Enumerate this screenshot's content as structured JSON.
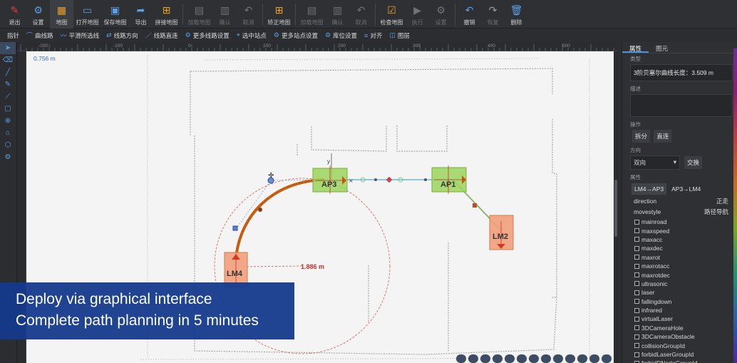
{
  "toolbar": [
    {
      "label": "退出",
      "icon": "exit-icon",
      "state": "normal"
    },
    {
      "label": "设置",
      "icon": "settings-icon",
      "state": "normal"
    },
    {
      "label": "地图",
      "icon": "map-grid-icon",
      "state": "active"
    },
    {
      "label": "打开地图",
      "icon": "folder-open-icon",
      "state": "normal"
    },
    {
      "label": "保存地图",
      "icon": "save-icon",
      "state": "normal"
    },
    {
      "label": "导出",
      "icon": "export-icon",
      "state": "normal"
    },
    {
      "label": "拼接地图",
      "icon": "merge-map-icon",
      "state": "normal"
    },
    {
      "label": "加载地图",
      "icon": "load-map-icon",
      "state": "disabled"
    },
    {
      "label": "确认",
      "icon": "confirm-icon",
      "state": "disabled"
    },
    {
      "label": "取消",
      "icon": "undo-cancel-icon",
      "state": "disabled"
    },
    {
      "label": "矫正地图",
      "icon": "correct-map-icon",
      "state": "normal"
    },
    {
      "label": "加载地图",
      "icon": "load-map-icon",
      "state": "disabled"
    },
    {
      "label": "确认",
      "icon": "confirm-icon",
      "state": "disabled"
    },
    {
      "label": "取消",
      "icon": "undo-cancel-icon",
      "state": "disabled"
    },
    {
      "label": "检查地图",
      "icon": "check-map-icon",
      "state": "normal"
    },
    {
      "label": "执行",
      "icon": "play-icon",
      "state": "disabled"
    },
    {
      "label": "设置",
      "icon": "gear-icon",
      "state": "disabled"
    },
    {
      "label": "撤销",
      "icon": "undo-icon",
      "state": "normal"
    },
    {
      "label": "恢复",
      "icon": "redo-icon",
      "state": "disabled"
    },
    {
      "label": "删除",
      "icon": "trash-icon",
      "state": "normal"
    }
  ],
  "toolbar2": [
    {
      "label": "指针",
      "icon": ""
    },
    {
      "label": "曲线路",
      "icon": "curve-path-icon"
    },
    {
      "label": "平滑所选线",
      "icon": "smooth-line-icon"
    },
    {
      "label": "线路方向",
      "icon": "line-direction-icon"
    },
    {
      "label": "线路直连",
      "icon": "line-straight-icon"
    },
    {
      "label": "更多线路设置",
      "icon": "more-line-settings-icon"
    },
    {
      "label": "选中站点",
      "icon": "select-station-icon"
    },
    {
      "label": "更多站点设置",
      "icon": "more-station-settings-icon"
    },
    {
      "label": "库位设置",
      "icon": "storage-settings-icon"
    },
    {
      "label": "对齐",
      "icon": "align-icon"
    },
    {
      "label": "图层",
      "icon": "layers-icon"
    }
  ],
  "left_tools": [
    "pointer-icon",
    "eraser-icon",
    "line-tool-icon",
    "pen-tool-icon",
    "polyline-tool-icon",
    "rect-tool-icon",
    "station-tool-icon",
    "robot-tool-icon",
    "region-tool-icon",
    "gear-tool-icon"
  ],
  "ruler": {
    "top_labels": [
      "-200",
      "-100",
      "0",
      "100",
      "200",
      "300",
      "400",
      "500"
    ]
  },
  "canvas": {
    "measure_label": "0.756 m",
    "radius_label": "1.886 m",
    "axis_label_y": "y",
    "stations": [
      {
        "name": "AP3"
      },
      {
        "name": "AP1"
      },
      {
        "name": "LM2"
      },
      {
        "name": "LM4"
      }
    ]
  },
  "panel": {
    "tabs": [
      "属性",
      "图元"
    ],
    "type_label": "类型",
    "type_value": "3阶贝塞尔曲线长度：3.509 m",
    "desc_label": "描述",
    "ops_label": "操作",
    "ops_buttons": [
      "拆分",
      "直连"
    ],
    "dir_label": "方向",
    "dir_value": "双向",
    "dir_swap": "交换",
    "attr_label": "属性",
    "attr_tabs": [
      "LM4→AP3",
      "AP3→LM4"
    ],
    "direction_key": "direction",
    "direction_val": "正走",
    "movestyle_key": "movestyle",
    "movestyle_val": "路径导航",
    "checkboxes": [
      "mainroad",
      "maxspeed",
      "maxacc",
      "maxdec",
      "maxrot",
      "maxrotacc",
      "maxrotdec",
      "ultrasonic",
      "laser",
      "fallingdown",
      "infrared",
      "virtualLaser",
      "3DCameraHole",
      "3DCameraObstacle",
      "collisionGroupId",
      "forbidLaserGroupId",
      "forbidDNodeGroupId"
    ]
  },
  "caption": {
    "line1": "Deploy via graphical interface",
    "line2": "Complete path planning in 5 minutes"
  },
  "colors": {
    "accent_orange": "#f0a020",
    "accent_blue": "#4a90e2",
    "station_green": "#9ad45a",
    "station_orange": "#f2a07a",
    "path_orange": "#c85a10",
    "caption_bg": "#143a8c"
  }
}
